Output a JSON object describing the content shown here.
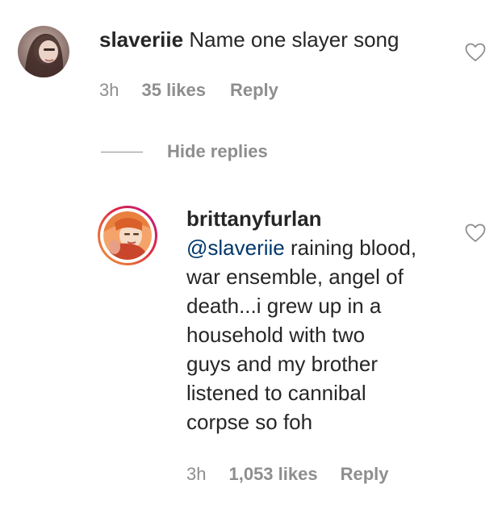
{
  "comment": {
    "username": "slaveriie",
    "text": "Name one slayer song",
    "time": "3h",
    "likes": "35 likes",
    "reply_label": "Reply",
    "like_icon": "heart-outline-icon"
  },
  "thread": {
    "hide_replies_label": "Hide replies"
  },
  "reply": {
    "username": "brittanyfurlan",
    "mention": "@slaveriie",
    "text_lines": [
      " raining blood,",
      "war ensemble, angel of",
      "death...i grew up in a",
      "household with two",
      "guys and my brother",
      "listened to cannibal",
      "corpse so foh"
    ],
    "time": "3h",
    "likes": "1,053 likes",
    "reply_label": "Reply",
    "like_icon": "heart-outline-icon",
    "story_ring_colors": [
      "#f09433",
      "#dc2743",
      "#bc1888"
    ]
  }
}
